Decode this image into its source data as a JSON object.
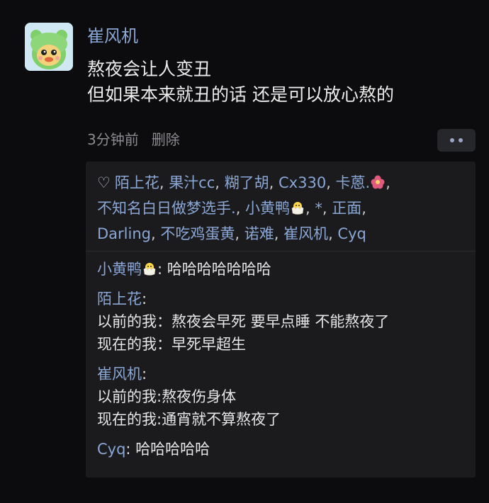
{
  "post": {
    "author": "崔风机",
    "lines": [
      "熬夜会让人变丑",
      "但如果本来就丑的话 还是可以放心熬的"
    ],
    "time": "3分钟前",
    "delete_label": "删除",
    "more_icon": "more-dots-icon"
  },
  "likes": {
    "icon": "heart-icon",
    "names": [
      "陌上花",
      "果汁cc",
      "糊了胡",
      "Cx330",
      "卡蒽.",
      "不知名白日做梦选手.",
      "小黄鸭",
      "*",
      "正面",
      "Darling",
      "不吃鸡蛋黄",
      "诺难",
      "崔风机",
      "Cyq"
    ]
  },
  "comments": [
    {
      "name": "小黄鸭",
      "sep": ": ",
      "text": "哈哈哈哈哈哈哈",
      "lines": []
    },
    {
      "name": "陌上花",
      "sep": ":",
      "text": "",
      "lines": [
        "以前的我：熬夜会早死 要早点睡 不能熬夜了",
        "现在的我：早死早超生"
      ]
    },
    {
      "name": "崔风机",
      "sep": ":",
      "text": "",
      "lines": [
        "以前的我:熬夜伤身体",
        "现在的我:通宵就不算熬夜了"
      ]
    },
    {
      "name": "Cyq",
      "sep": ": ",
      "text": "哈哈哈哈哈",
      "lines": []
    }
  ],
  "colors": {
    "background": "#0c0c0e",
    "panel": "#1b1b1e",
    "name_blue": "#8aa7d6",
    "text": "#ececec",
    "meta_gray": "#8b8b90"
  }
}
